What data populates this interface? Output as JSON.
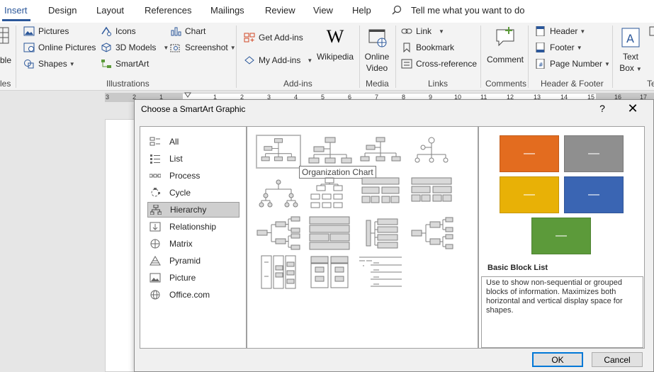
{
  "tabs": [
    {
      "label": "Insert",
      "active": true
    },
    {
      "label": "Design"
    },
    {
      "label": "Layout"
    },
    {
      "label": "References"
    },
    {
      "label": "Mailings"
    },
    {
      "label": "Review"
    },
    {
      "label": "View"
    },
    {
      "label": "Help"
    }
  ],
  "tellme": "Tell me what you want to do",
  "ribbon": {
    "table_partial": "ble",
    "tables_partial_label": "les",
    "illustrations": {
      "label": "Illustrations",
      "pictures": "Pictures",
      "online_pictures": "Online Pictures",
      "shapes": "Shapes",
      "icons": "Icons",
      "models_3d": "3D Models",
      "smartart": "SmartArt",
      "chart": "Chart",
      "screenshot": "Screenshot"
    },
    "addins": {
      "label": "Add-ins",
      "get_addins": "Get Add-ins",
      "my_addins": "My Add-ins",
      "wikipedia": "Wikipedia"
    },
    "media": {
      "label": "Media",
      "online": "Online",
      "video": "Video"
    },
    "links": {
      "label": "Links",
      "link": "Link",
      "bookmark": "Bookmark",
      "cross_reference": "Cross-reference"
    },
    "comments": {
      "label": "Comments",
      "comment": "Comment"
    },
    "header_footer": {
      "label": "Header & Footer",
      "header": "Header",
      "footer": "Footer",
      "page_number": "Page Number"
    },
    "text": {
      "label_partial": "Te",
      "text": "Text",
      "box": "Box"
    }
  },
  "ruler_numbers": [
    "3",
    "2",
    "1",
    "1",
    "2",
    "3",
    "4",
    "5",
    "6",
    "7",
    "8",
    "9",
    "10",
    "11",
    "12",
    "13",
    "14",
    "15",
    "16",
    "17"
  ],
  "dialog": {
    "title": "Choose a SmartArt Graphic",
    "help": "?",
    "close": "✕",
    "categories": [
      {
        "label": "All",
        "icon": "all-icon"
      },
      {
        "label": "List",
        "icon": "list-icon"
      },
      {
        "label": "Process",
        "icon": "process-icon"
      },
      {
        "label": "Cycle",
        "icon": "cycle-icon"
      },
      {
        "label": "Hierarchy",
        "icon": "hierarchy-icon",
        "selected": true
      },
      {
        "label": "Relationship",
        "icon": "relationship-icon"
      },
      {
        "label": "Matrix",
        "icon": "matrix-icon"
      },
      {
        "label": "Pyramid",
        "icon": "pyramid-icon"
      },
      {
        "label": "Picture",
        "icon": "picture-icon"
      },
      {
        "label": "Office.com",
        "icon": "globe-icon"
      }
    ],
    "tooltip": "Organization Chart",
    "preview": {
      "title": "Basic Block List",
      "description": "Use to show non-sequential or grouped blocks of information. Maximizes both horizontal and vertical display space for shapes.",
      "swatch_colors": [
        "#e36c1f",
        "#8f8f8f",
        "#e8b106",
        "#3a65b3",
        "#5c9a3a"
      ],
      "swatch_text": "—"
    },
    "ok": "OK",
    "cancel": "Cancel"
  }
}
